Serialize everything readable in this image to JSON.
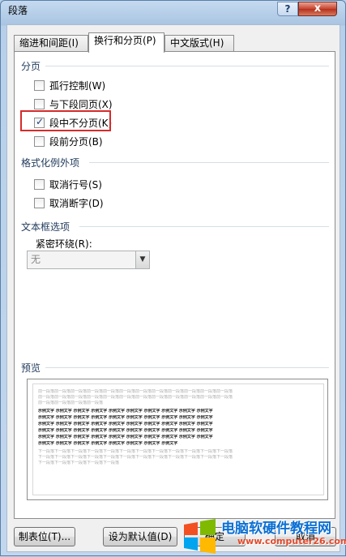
{
  "window": {
    "title": "段落",
    "help": "?",
    "close": "x"
  },
  "tabs": [
    {
      "label": "缩进和间距(I)"
    },
    {
      "label": "换行和分页(P)"
    },
    {
      "label": "中文版式(H)"
    }
  ],
  "pagination": {
    "label": "分页",
    "items": [
      {
        "label": "孤行控制(W)",
        "checked": false
      },
      {
        "label": "与下段同页(X)",
        "checked": false
      },
      {
        "label": "段中不分页(K)",
        "checked": true
      },
      {
        "label": "段前分页(B)",
        "checked": false
      }
    ]
  },
  "exceptions": {
    "label": "格式化例外项",
    "items": [
      {
        "label": "取消行号(S)",
        "checked": false
      },
      {
        "label": "取消断字(D)",
        "checked": false
      }
    ]
  },
  "textbox": {
    "label": "文本框选项",
    "wrap_label": "紧密环绕(R):",
    "wrap_value": "无"
  },
  "preview": {
    "label": "预览",
    "line_prev": "前一段落前一段落前一段落前一段落前一段落前一段落前一段落前一段落前一段落前一段落前一段落前一段落",
    "line_prev_short": "前一段落前一段落前一段落前一段落",
    "line_sample": "示例文字 示例文字 示例文字 示例文字 示例文字 示例文字 示例文字 示例文字 示例文字 示例文字",
    "line_sample_short": "示例文字 示例文字 示例文字 示例文字 示例文字 示例文字 示例文字 示例文字",
    "line_next": "下一段落下一段落下一段落下一段落下一段落下一段落下一段落下一段落下一段落下一段落下一段落下一段落",
    "line_next_short": "下一段落下一段落下一段落下一段落下一段落"
  },
  "buttons": {
    "tabs": "制表位(T)...",
    "default": "设为默认值(D)",
    "ok": "确定",
    "cancel": "取消"
  },
  "watermark": {
    "name": "电脑软硬件教程网",
    "url": "www.computer26.com"
  }
}
